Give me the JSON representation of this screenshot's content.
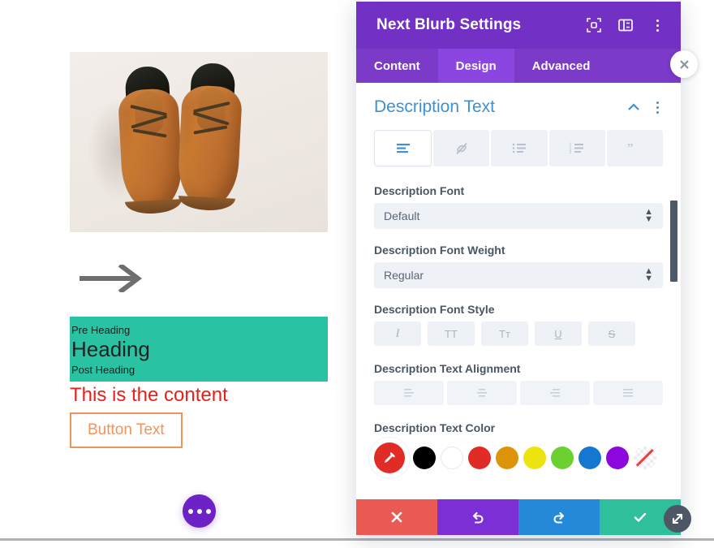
{
  "preview": {
    "image_alt": "brown-leather-shoes-photo",
    "arrow_icon": "arrow-right-icon",
    "pre_heading": "Pre Heading",
    "heading": "Heading",
    "post_heading": "Post Heading",
    "content": "This is the content",
    "button_label": "Button Text",
    "heading_bg_color": "#29c3a3",
    "content_color": "#e8201a",
    "button_border_color": "#f2935c",
    "fab_icon": "ellipsis-icon",
    "fab_color": "#6c22c4"
  },
  "modal": {
    "title": "Next Blurb Settings",
    "header_icons": [
      {
        "name": "focus-frame-icon"
      },
      {
        "name": "layout-panel-icon"
      },
      {
        "name": "kebab-menu-icon"
      }
    ],
    "header_color": "#7230c4",
    "tabs": [
      {
        "label": "Content",
        "active": false
      },
      {
        "label": "Design",
        "active": true
      },
      {
        "label": "Advanced",
        "active": false
      }
    ],
    "section": {
      "title": "Description Text",
      "collapse_icon": "chevron-up-icon",
      "menu_icon": "kebab-menu-icon",
      "accent_color": "#3f8fd2"
    },
    "format_toolbar": [
      {
        "name": "text-align-left-icon",
        "selected": true
      },
      {
        "name": "link-off-icon",
        "selected": false
      },
      {
        "name": "bulleted-list-icon",
        "selected": false
      },
      {
        "name": "numbered-list-icon",
        "selected": false
      },
      {
        "name": "blockquote-icon",
        "selected": false
      }
    ],
    "fields": [
      {
        "label": "Description Font",
        "value": "Default",
        "name": "description-font-select"
      },
      {
        "label": "Description Font Weight",
        "value": "Regular",
        "name": "description-font-weight-select"
      }
    ],
    "font_style": {
      "label": "Description Font Style",
      "options": [
        {
          "glyph": "I",
          "name": "italic-button"
        },
        {
          "glyph": "TT",
          "name": "uppercase-button"
        },
        {
          "glyph": "Tᴛ",
          "name": "small-caps-button"
        },
        {
          "glyph": "U",
          "name": "underline-button"
        },
        {
          "glyph": "S",
          "name": "strikethrough-button"
        }
      ]
    },
    "text_alignment": {
      "label": "Description Text Alignment",
      "options": [
        {
          "name": "align-left-button"
        },
        {
          "name": "align-center-button"
        },
        {
          "name": "align-right-button"
        },
        {
          "name": "align-justify-button"
        }
      ]
    },
    "text_color": {
      "label": "Description Text Color",
      "picker_icon": "eyedropper-icon",
      "picker_color": "#e02b27",
      "swatches": [
        {
          "color": "#000000",
          "name": "swatch-black"
        },
        {
          "color": "#ffffff",
          "name": "swatch-white"
        },
        {
          "color": "#e02b27",
          "name": "swatch-red"
        },
        {
          "color": "#dd9409",
          "name": "swatch-orange"
        },
        {
          "color": "#ede30e",
          "name": "swatch-yellow"
        },
        {
          "color": "#6bd130",
          "name": "swatch-green"
        },
        {
          "color": "#1577cf",
          "name": "swatch-blue"
        },
        {
          "color": "#8c07dd",
          "name": "swatch-purple"
        },
        {
          "color": "none",
          "name": "swatch-transparent"
        }
      ]
    },
    "footer": [
      {
        "name": "cancel-button",
        "icon": "close-icon",
        "color": "#ea5a53"
      },
      {
        "name": "undo-button",
        "icon": "undo-icon",
        "color": "#7b2fd4"
      },
      {
        "name": "redo-button",
        "icon": "redo-icon",
        "color": "#2589d9"
      },
      {
        "name": "save-button",
        "icon": "check-icon",
        "color": "#2fbf9b"
      }
    ]
  },
  "overlay": {
    "close_icon": "close-circle-icon",
    "resize_icon": "resize-diagonal-icon"
  }
}
